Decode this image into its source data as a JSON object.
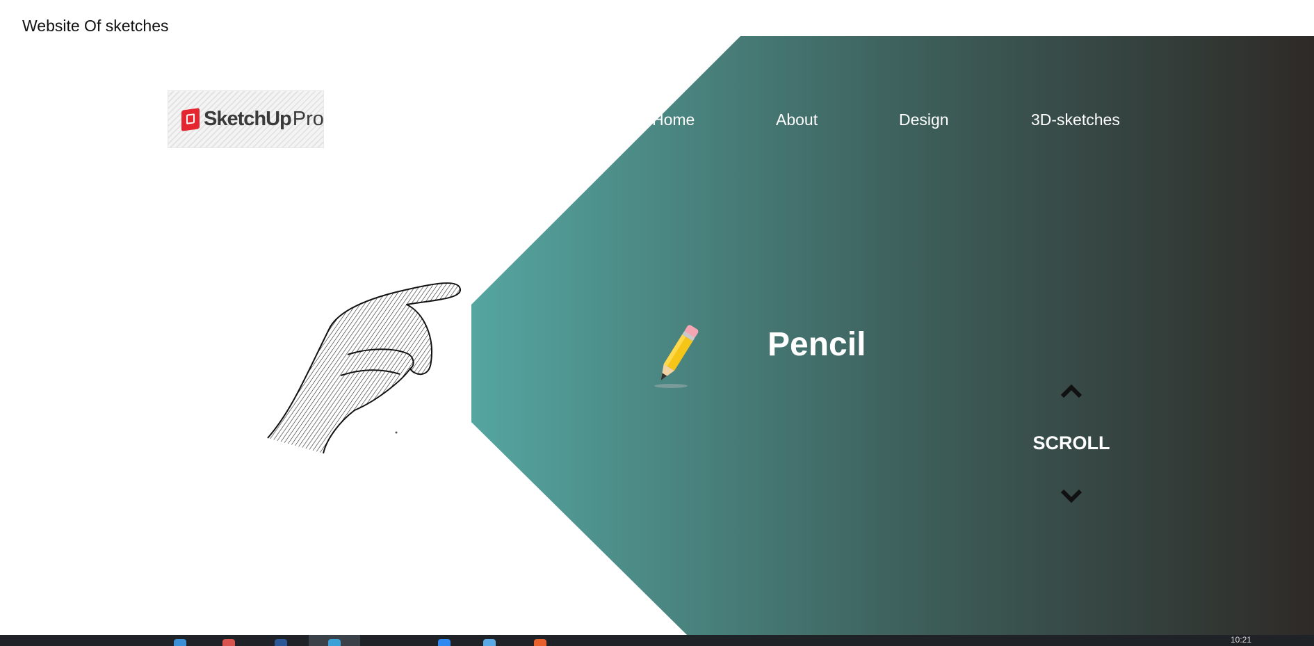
{
  "page": {
    "title": "Website Of sketches"
  },
  "logo": {
    "name": "SketchUp",
    "suffix": "Pro"
  },
  "nav": [
    {
      "label": "Home"
    },
    {
      "label": "About"
    },
    {
      "label": "Design"
    },
    {
      "label": "3D-sketches"
    }
  ],
  "hero": {
    "heading": "Pencil",
    "scroll_label": "SCROLL"
  },
  "taskbar": {
    "clock": "10:21"
  },
  "colors": {
    "gradient_start": "#55a5a0",
    "gradient_mid": "#3d5e5a",
    "gradient_end": "#2e2a27",
    "text_light": "#ffffff"
  }
}
